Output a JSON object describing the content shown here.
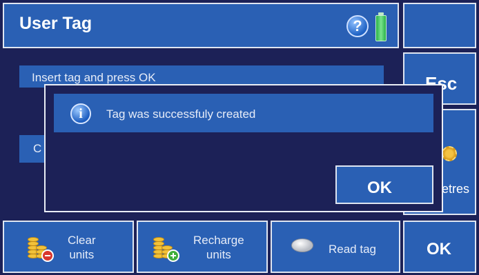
{
  "header": {
    "title": "User Tag"
  },
  "side_buttons": {
    "esc_label": "Esc",
    "parameters_partial_label": "netres"
  },
  "background": {
    "instruction_text": "Insert tag and press OK",
    "second_row_partial": "C"
  },
  "dialog": {
    "message": "Tag was successfuly created",
    "ok_label": "OK"
  },
  "toolbar": {
    "clear_units": [
      "Clear",
      "units"
    ],
    "recharge_units": [
      "Recharge",
      "units"
    ],
    "read_tag": "Read tag",
    "ok_label": "OK"
  },
  "icons": [
    "help-icon",
    "battery-icon",
    "gear-icon",
    "info-icon",
    "coins-minus-icon",
    "coins-plus-icon",
    "tag-icon"
  ],
  "colors": {
    "panel_blue": "#2a60b4",
    "background_navy": "#1c2157",
    "border": "#dfe6f2",
    "battery_green": "#28b048"
  }
}
